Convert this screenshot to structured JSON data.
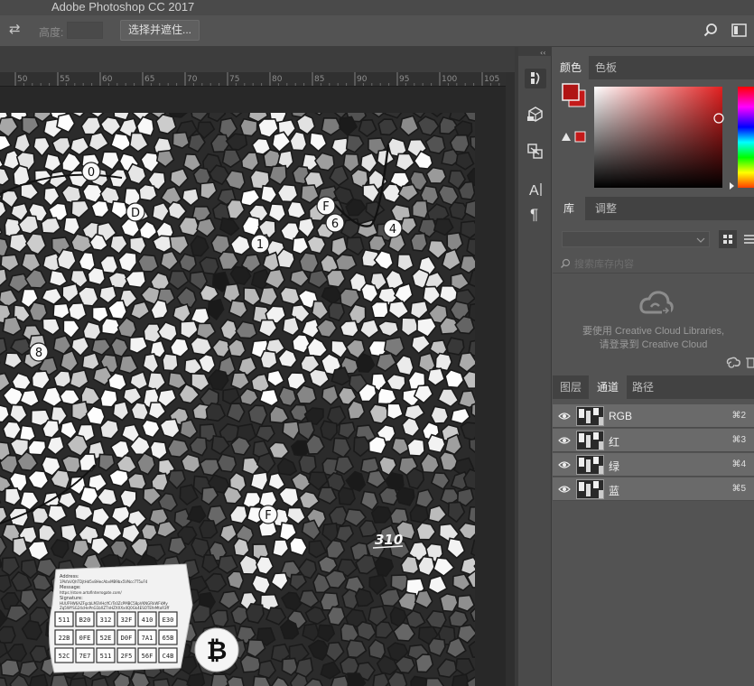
{
  "app": {
    "title": "Adobe Photoshop CC 2017"
  },
  "options_bar": {
    "height_label": "高度:",
    "height_value": "",
    "select_mask_button": "选择并遮住..."
  },
  "ruler": {
    "labels": [
      "50",
      "55",
      "60",
      "65",
      "70",
      "75",
      "80",
      "85",
      "90",
      "95",
      "100",
      "105"
    ]
  },
  "tool_icons": [
    "history-icon",
    "cube-icon",
    "swap-brush-icon",
    "character-icon",
    "paragraph-icon"
  ],
  "color_panel": {
    "tabs": [
      "颜色",
      "色板"
    ],
    "active_tab": "颜色",
    "foreground_color": "#b01515",
    "background_color": "#c41a1a",
    "gamut_warning_color": "#c41a1a",
    "picker_hue": "#e22020"
  },
  "library_panel": {
    "tabs": [
      "库",
      "调整"
    ],
    "active_tab": "库",
    "search_placeholder": "搜索库存内容",
    "message_line1": "要使用 Creative Cloud Libraries,",
    "message_line2": "请登录到 Creative Cloud"
  },
  "channels_panel": {
    "tabs": [
      "图层",
      "通道",
      "路径"
    ],
    "active_tab": "通道",
    "channels": [
      {
        "name": "RGB",
        "shortcut": "⌘2"
      },
      {
        "name": "红",
        "shortcut": "⌘3"
      },
      {
        "name": "绿",
        "shortcut": "⌘4"
      },
      {
        "name": "蓝",
        "shortcut": "⌘5"
      }
    ]
  },
  "artwork": {
    "labels": [
      "0",
      "D",
      "F",
      "6",
      "4",
      "1",
      "8",
      "F",
      "310"
    ],
    "card_header": [
      "Address:",
      "Message:",
      "Signature:"
    ],
    "card_lines": [
      "1PkfaVQhTDjtHd5v8HecAbvMB9bx5VNcc7T5uF4",
      "https://store.artofinterrogate.com/",
      "HUUF9W6AZFgcbLM3VHcIfCrTs0ZcPMBC58pVKNGRkWFkMy",
      "Zq5WYSG24cHePnG1bXZTnHZXXXx4Q0Gk4ESOTEfeMtoR3ff"
    ],
    "grid": [
      "511",
      "B20",
      "312",
      "32F",
      "410",
      "E30",
      "22B",
      "0FE",
      "52E",
      "D0F",
      "7A1",
      "65B",
      "52C",
      "7E7",
      "511",
      "2F5",
      "56F",
      "C4B"
    ],
    "coin_symbol": "₿"
  }
}
